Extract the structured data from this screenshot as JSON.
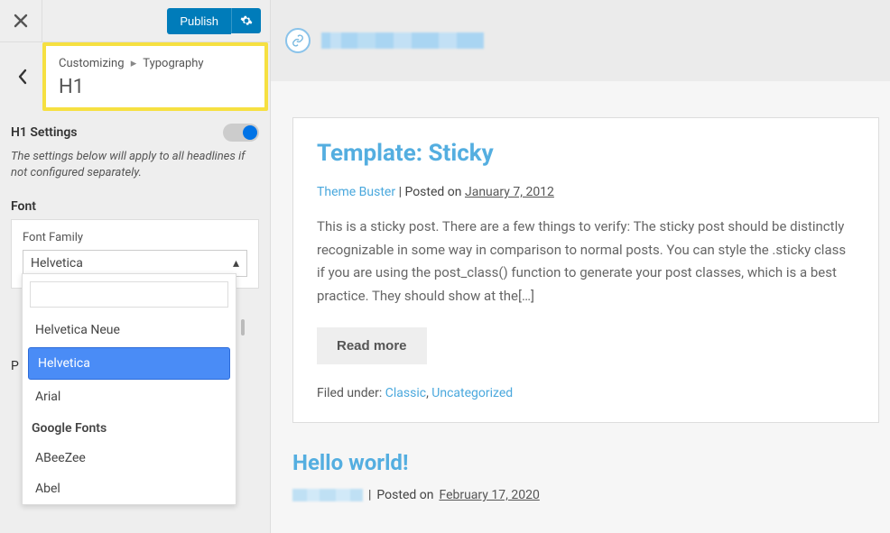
{
  "header": {
    "publish_label": "Publish"
  },
  "breadcrumb": {
    "root": "Customizing",
    "parent": "Typography",
    "title": "H1"
  },
  "h1_settings": {
    "title": "H1 Settings",
    "description": "The settings below will apply to all headlines if not configured separately.",
    "enabled": true
  },
  "font_section": {
    "label": "Font",
    "font_family_label": "Font Family",
    "selected": "Helvetica"
  },
  "dropdown": {
    "search_value": "",
    "items_top": [
      "Helvetica Neue",
      "Helvetica",
      "Arial"
    ],
    "selected_index": 1,
    "group_label": "Google Fonts",
    "items_google": [
      "ABeeZee",
      "Abel"
    ]
  },
  "peek_label": "P",
  "preview": {
    "posts": [
      {
        "title": "Template: Sticky",
        "author": "Theme Buster",
        "posted_on_label": "Posted on",
        "date": "January 7, 2012",
        "excerpt": "This is a sticky post. There are a few things to verify: The sticky post should be distinctly recognizable in some way in comparison to normal posts. You can style the .sticky class if you are using the post_class() function to generate your post classes, which is a best practice. They should show at the[…]",
        "readmore": "Read more",
        "filed_label": "Filed under:",
        "cats": [
          "Classic",
          "Uncategorized"
        ]
      },
      {
        "title": "Hello world!",
        "posted_on_label": "Posted on",
        "date": "February 17, 2020"
      }
    ]
  }
}
